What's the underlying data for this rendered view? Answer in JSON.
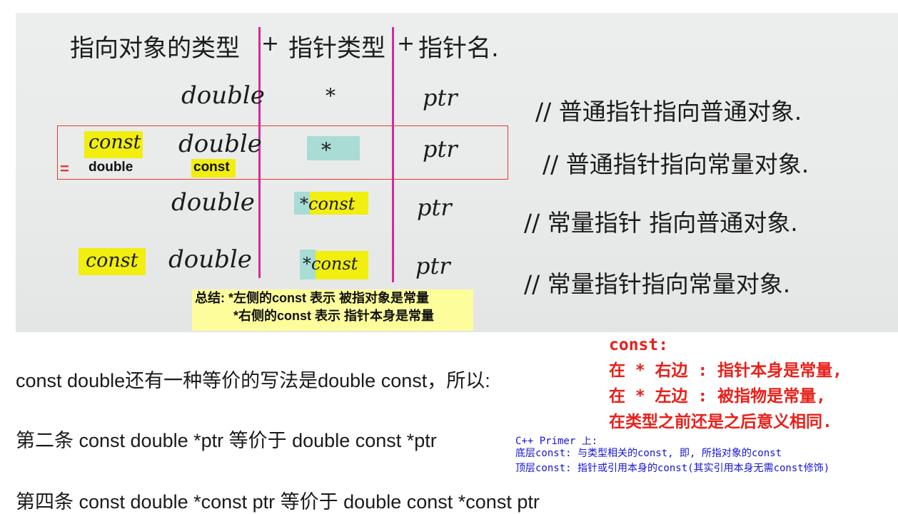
{
  "photo": {
    "header": {
      "col1": "指向对象的类型",
      "plus1": "+",
      "col2": "指针类型",
      "plus2": "+",
      "col3": "指针名."
    },
    "rows": [
      {
        "prefix": "",
        "type": "double",
        "ptr_type": "*",
        "name": "ptr",
        "comment": "// 普通指针指向普通对象."
      },
      {
        "prefix": "const",
        "type": "double",
        "ptr_type": "*",
        "name": "ptr",
        "comment": "// 普通指针指向常量对象."
      },
      {
        "prefix": "",
        "type": "double",
        "ptr_type": "*const",
        "name": "ptr",
        "comment": "// 常量指针 指向普通对象."
      },
      {
        "prefix": "const",
        "type": "double",
        "ptr_type": "*const",
        "name": "ptr",
        "comment": "// 常量指针指向常量对象."
      }
    ],
    "equiv": {
      "sign": "=",
      "word1": "double",
      "word2": "const"
    },
    "summary": {
      "line1": "总结: *左侧的const 表示 被指对象是常量",
      "line2": "*右侧的const  表示 指针本身是常量"
    }
  },
  "body": {
    "p1": "const double还有一种等价的写法是double const，所以:",
    "p2": "第二条 const double *ptr 等价于 double const *ptr",
    "p3": "第四条 const double *const ptr 等价于 double const *const ptr"
  },
  "red_note": {
    "line1": "const:",
    "line2": "在 * 右边 : 指针本身是常量,",
    "line3": "在 * 左边 : 被指物是常量,",
    "line4": "在类型之前还是之后意义相同."
  },
  "primer_note": {
    "line1": "C++ Primer 上:",
    "line2": "底层const: 与类型相关的const, 即, 所指对象的const",
    "line3": "顶层const: 指针或引用本身的const(其实引用本身无需const修饰)"
  },
  "colors": {
    "divider": "#d42a9a",
    "highlight_yellow": "#f1ee10",
    "highlight_cyan": "#a8dcd4",
    "red": "#e8201a",
    "blue": "#1414d6"
  }
}
